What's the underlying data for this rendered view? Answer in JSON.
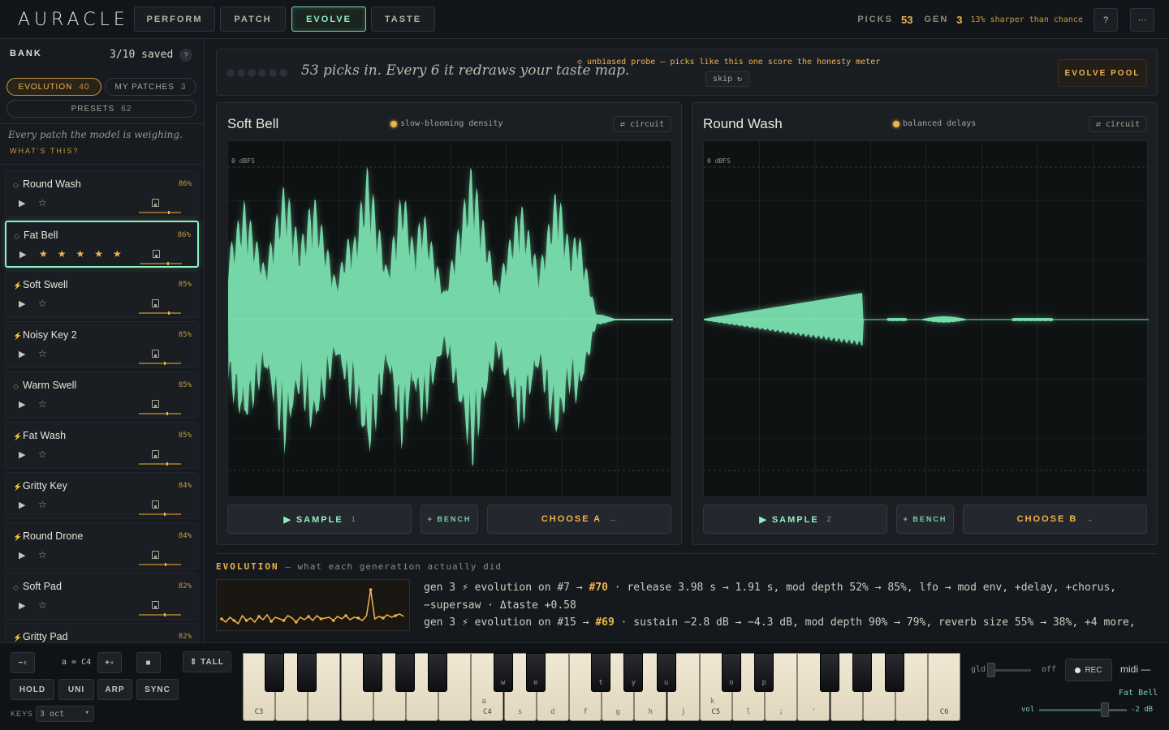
{
  "app": {
    "logo": "AURACLE"
  },
  "nav": {
    "tabs": [
      {
        "label": "PERFORM"
      },
      {
        "label": "PATCH"
      },
      {
        "label": "EVOLVE",
        "active": true
      },
      {
        "label": "TASTE"
      }
    ]
  },
  "stats": {
    "picks_label": "PICKS",
    "picks_value": "53",
    "gen_label": "GEN",
    "gen_value": "3",
    "note": "13% sharper than chance"
  },
  "top_buttons": {
    "help": "?",
    "more": "···"
  },
  "bank": {
    "title": "BANK",
    "count": "3/10 saved",
    "help": "?",
    "filters": [
      {
        "label": "EVOLUTION",
        "count": "40",
        "active": true
      },
      {
        "label": "MY PATCHES",
        "count": "3"
      },
      {
        "label": "PRESETS",
        "count": "62"
      }
    ],
    "description": "Every patch the model is weighing.",
    "whats_this": "WHAT'S THIS?",
    "items": [
      {
        "name": "Round Wash",
        "pct": "86%",
        "icon": "◇",
        "stars": "☆",
        "level": 0.7
      },
      {
        "name": "Fat Bell",
        "pct": "86%",
        "icon": "◇",
        "stars": "★★★★★",
        "selected": true,
        "level": 0.65
      },
      {
        "name": "Soft Swell",
        "pct": "85%",
        "icon": "⚡",
        "stars": "☆",
        "level": 0.7
      },
      {
        "name": "Noisy Key 2",
        "pct": "85%",
        "icon": "⚡",
        "stars": "☆",
        "level": 0.6
      },
      {
        "name": "Warm Swell",
        "pct": "85%",
        "icon": "◇",
        "stars": "☆",
        "level": 0.65
      },
      {
        "name": "Fat Wash",
        "pct": "85%",
        "icon": "⚡",
        "stars": "☆",
        "level": 0.65
      },
      {
        "name": "Gritty Key",
        "pct": "84%",
        "icon": "⚡",
        "stars": "☆",
        "level": 0.6
      },
      {
        "name": "Round Drone",
        "pct": "84%",
        "icon": "⚡",
        "stars": "☆",
        "level": 0.62
      },
      {
        "name": "Soft Pad",
        "pct": "82%",
        "icon": "◇",
        "stars": "☆",
        "level": 0.6
      },
      {
        "name": "Gritty Pad",
        "pct": "82%",
        "icon": "⚡",
        "stars": "☆",
        "level": 0.6
      }
    ]
  },
  "banner": {
    "text": "53 picks in. Every 6 it redraws your taste map.",
    "probe": "◇ unbiased probe — picks like this one score the honesty meter",
    "skip": "skip ↻",
    "evolve": "EVOLVE POOL"
  },
  "cards": [
    {
      "title": "Soft Bell",
      "tag": "slow-blooming density",
      "circuit": "⇄ circuit",
      "dbfs": "0 dBFS",
      "sample": "▶ SAMPLE",
      "sample_key": "1",
      "bench": "+ BENCH",
      "choose": "CHOOSE A",
      "choose_key": "←"
    },
    {
      "title": "Round Wash",
      "tag": "balanced delays",
      "circuit": "⇄ circuit",
      "dbfs": "0 dBFS",
      "sample": "▶ SAMPLE",
      "sample_key": "2",
      "bench": "+ BENCH",
      "choose": "CHOOSE B",
      "choose_key": "→"
    }
  ],
  "evolution": {
    "title": "EVOLUTION",
    "subtitle": "— what each generation actually did",
    "line1a": "gen 3 ⚡ evolution on #7 → ",
    "line1b": "#70",
    "line1c": " · release 3.98 s → 1.91 s, mod depth 52% → 85%, lfo → mod env, +delay, +chorus, −supersaw · Δtaste +0.58",
    "line2a": "gen 3 ⚡ evolution on #15 → ",
    "line2b": "#69",
    "line2c": " · sustain −2.8 dB → −4.3 dB, mod depth 90% → 79%, reverb size 55% → 38%, +4 more,"
  },
  "bottom": {
    "oct_down": "−",
    "oct_down_sub": "z",
    "a_eq": "a = C4",
    "oct_up": "+",
    "oct_up_sub": "x",
    "stop": "■",
    "tall": "⇕ TALL",
    "hold": "HOLD",
    "uni": "UNI",
    "arp": "ARP",
    "sync": "SYNC",
    "keys_label": "KEYS",
    "keys_value": "3 oct",
    "gld": "gld",
    "off": "off",
    "rec": "REC",
    "midi": "midi —",
    "patch": "Fat Bell",
    "vol": "vol",
    "vol_value": "-2 dB"
  },
  "keyboard": {
    "white": [
      {
        "note": "C3"
      },
      {},
      {},
      {},
      {},
      {},
      {},
      {
        "note": "C4",
        "key": "a"
      },
      {
        "key": "s"
      },
      {
        "key": "d"
      },
      {
        "key": "f"
      },
      {
        "key": "g"
      },
      {
        "key": "h"
      },
      {
        "key": "j"
      },
      {
        "note": "C5",
        "key": "k"
      },
      {
        "key": "l"
      },
      {
        "key": ";"
      },
      {
        "key": "'"
      },
      {},
      {},
      {},
      {
        "note": "C6"
      }
    ],
    "black": [
      {},
      {},
      {},
      {},
      {},
      {
        "key": "w"
      },
      {
        "key": "e"
      },
      {
        "key": "t"
      },
      {
        "key": "y"
      },
      {
        "key": "u"
      },
      {
        "key": "o"
      },
      {
        "key": "p"
      },
      {},
      {},
      {}
    ]
  },
  "colors": {
    "accent_green": "#8ff0c2",
    "accent_amber": "#f0b44c",
    "wave": "#7ee8b4"
  }
}
